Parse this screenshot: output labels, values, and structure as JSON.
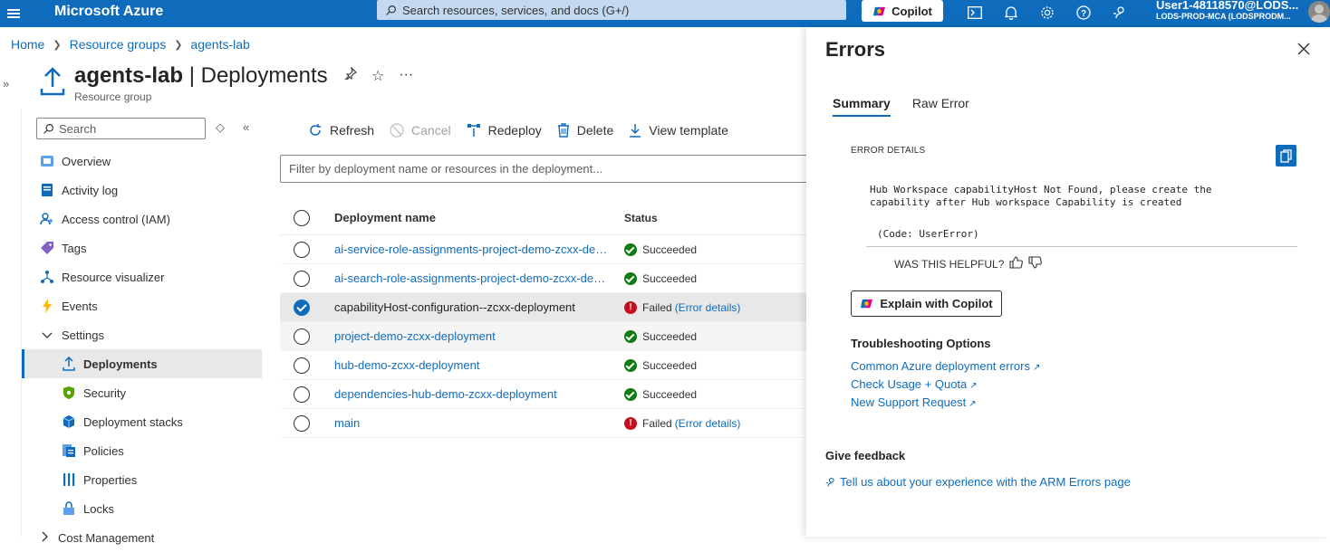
{
  "topbar": {
    "brand": "Microsoft Azure",
    "search_placeholder": "Search resources, services, and docs (G+/)",
    "copilot_label": "Copilot",
    "user_name": "User1-48118570@LODS...",
    "user_tenant": "LODS-PROD-MCA (LODSPRODM..."
  },
  "breadcrumb": [
    "Home",
    "Resource groups",
    "agents-lab"
  ],
  "header": {
    "name": "agents-lab",
    "separator": " | ",
    "section": "Deployments",
    "subtitle": "Resource group",
    "more": "···"
  },
  "nav": {
    "search_placeholder": "Search",
    "items": [
      {
        "label": "Overview",
        "icon": "overview-icon"
      },
      {
        "label": "Activity log",
        "icon": "activity-log-icon"
      },
      {
        "label": "Access control (IAM)",
        "icon": "iam-icon"
      },
      {
        "label": "Tags",
        "icon": "tag-icon"
      },
      {
        "label": "Resource visualizer",
        "icon": "visualizer-icon"
      },
      {
        "label": "Events",
        "icon": "lightning-icon"
      },
      {
        "label": "Settings",
        "icon": "chevron-down-icon"
      },
      {
        "label": "Deployments",
        "icon": "upload-icon"
      },
      {
        "label": "Security",
        "icon": "shield-icon"
      },
      {
        "label": "Deployment stacks",
        "icon": "cube-icon"
      },
      {
        "label": "Policies",
        "icon": "policy-icon"
      },
      {
        "label": "Properties",
        "icon": "properties-icon"
      },
      {
        "label": "Locks",
        "icon": "lock-icon"
      },
      {
        "label": "Cost Management",
        "icon": "chevron-right-icon"
      }
    ]
  },
  "toolbar": {
    "refresh": "Refresh",
    "cancel": "Cancel",
    "redeploy": "Redeploy",
    "delete": "Delete",
    "view_template": "View template"
  },
  "filter_placeholder": "Filter by deployment name or resources in the deployment...",
  "table": {
    "col_name": "Deployment name",
    "col_status": "Status",
    "rows": [
      {
        "name": "ai-service-role-assignments-project-demo-zcxx-deployment",
        "status": "Succeeded",
        "link": ""
      },
      {
        "name": "ai-search-role-assignments-project-demo-zcxx-deployment",
        "status": "Succeeded",
        "link": ""
      },
      {
        "name": "capabilityHost-configuration--zcxx-deployment",
        "status": "Failed",
        "link": "(Error details)"
      },
      {
        "name": "project-demo-zcxx-deployment",
        "status": "Succeeded",
        "link": ""
      },
      {
        "name": "hub-demo-zcxx-deployment",
        "status": "Succeeded",
        "link": ""
      },
      {
        "name": "dependencies-hub-demo-zcxx-deployment",
        "status": "Succeeded",
        "link": ""
      },
      {
        "name": "main",
        "status": "Failed",
        "link": "(Error details)"
      }
    ]
  },
  "panel": {
    "title": "Errors",
    "tabs": [
      "Summary",
      "Raw Error"
    ],
    "error_details_label": "ERROR DETAILS",
    "message": "Hub Workspace capabilityHost Not Found, please create the\ncapability after Hub workspace Capability is created",
    "code": "(Code: UserError)",
    "helpful": "WAS THIS HELPFUL?",
    "explain": "Explain with Copilot",
    "troubleshooting_title": "Troubleshooting Options",
    "links": [
      "Common Azure deployment errors",
      "Check Usage + Quota",
      "New Support Request"
    ],
    "feedback_title": "Give feedback",
    "feedback_link": "Tell us about your experience with the ARM Errors page"
  },
  "colors": {
    "accent": "#0f6cbd",
    "success": "#107c10",
    "error": "#c50f1f"
  }
}
